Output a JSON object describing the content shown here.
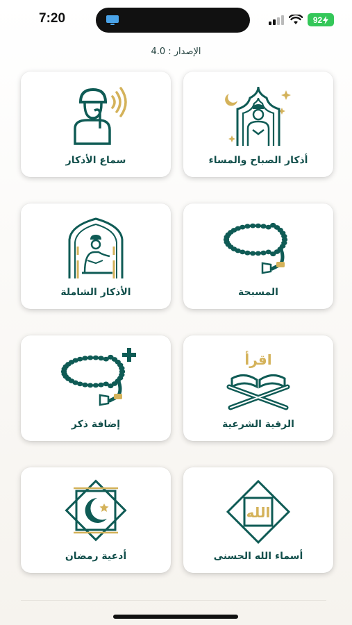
{
  "status_bar": {
    "time": "7:20",
    "battery": "92"
  },
  "version_text": "الإصدار : 4.0",
  "colors": {
    "teal": "#0f5b55",
    "gold": "#d4b25a",
    "label": "#124f4b"
  },
  "cards": [
    {
      "label": "أذكار الصباح والمساء",
      "icon": "praying-man-arch-icon"
    },
    {
      "label": "سماع الأذكار",
      "icon": "listening-man-icon"
    },
    {
      "label": "المسبحة",
      "icon": "prayer-beads-icon"
    },
    {
      "label": "الأذكار الشاملة",
      "icon": "praying-man-mihrab-icon"
    },
    {
      "label": "الرقية الشرعية",
      "icon": "quran-stand-icon"
    },
    {
      "label": "إضافة ذكر",
      "icon": "add-beads-icon"
    },
    {
      "label": "أسماء الله الحسنى",
      "icon": "allah-calligraphy-icon"
    },
    {
      "label": "أدعية رمضان",
      "icon": "ramadan-crescent-icon"
    }
  ],
  "icon_texts": {
    "iqra": "اقرأ",
    "allah": "الله"
  }
}
